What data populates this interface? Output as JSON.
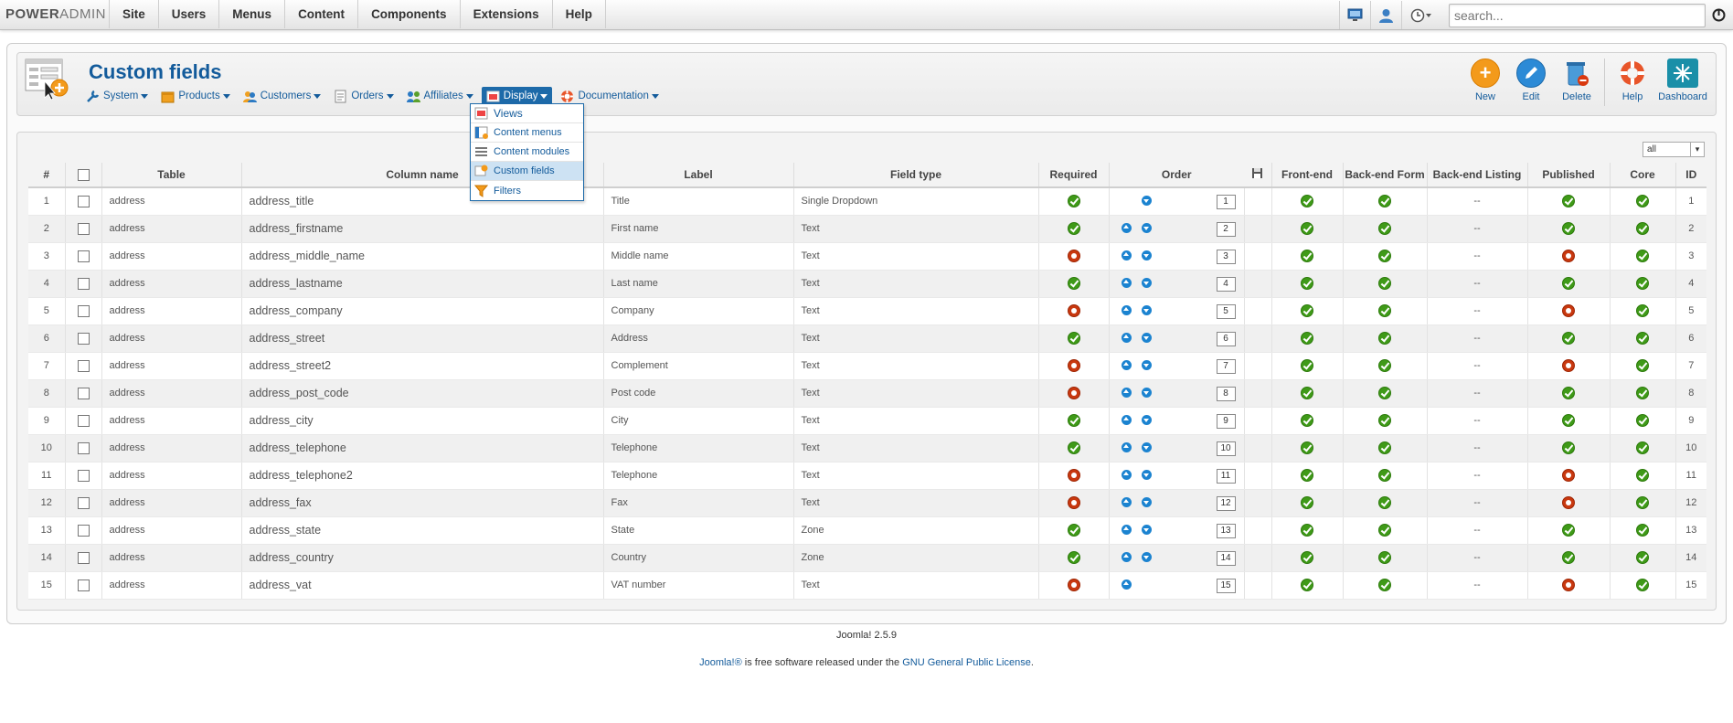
{
  "topbar": {
    "logo_bold": "POWER",
    "logo_thin": "ADMIN",
    "menu": [
      "Site",
      "Users",
      "Menus",
      "Content",
      "Components",
      "Extensions",
      "Help"
    ],
    "search_placeholder": "search..."
  },
  "header": {
    "title": "Custom fields",
    "subnav": [
      "System",
      "Products",
      "Customers",
      "Orders",
      "Affiliates",
      "Display",
      "Documentation"
    ],
    "active_subnav": "Display"
  },
  "toolbar": {
    "new_label": "New",
    "edit_label": "Edit",
    "delete_label": "Delete",
    "help_label": "Help",
    "dashboard_label": "Dashboard"
  },
  "dropdown": {
    "items": [
      "Views",
      "Content menus",
      "Content modules",
      "Custom fields",
      "Filters"
    ],
    "selected": "Custom fields"
  },
  "filter": {
    "value": "all"
  },
  "table": {
    "headers": [
      "#",
      "",
      "Table",
      "Column name",
      "Label",
      "Field type",
      "Required",
      "Order",
      "",
      "Front-end",
      "Back-end Form",
      "Back-end Listing",
      "Published",
      "Core",
      "ID"
    ],
    "rows": [
      {
        "num": "1",
        "table": "address",
        "column": "address_title",
        "label": "Title",
        "type": "Single Dropdown",
        "required": true,
        "up": false,
        "down": true,
        "order": "1",
        "front": true,
        "backform": true,
        "backlist": "--",
        "published": true,
        "core": true,
        "id": "1"
      },
      {
        "num": "2",
        "table": "address",
        "column": "address_firstname",
        "label": "First name",
        "type": "Text",
        "required": true,
        "up": true,
        "down": true,
        "order": "2",
        "front": true,
        "backform": true,
        "backlist": "--",
        "published": true,
        "core": true,
        "id": "2"
      },
      {
        "num": "3",
        "table": "address",
        "column": "address_middle_name",
        "label": "Middle name",
        "type": "Text",
        "required": false,
        "up": true,
        "down": true,
        "order": "3",
        "front": true,
        "backform": true,
        "backlist": "--",
        "published": false,
        "core": true,
        "id": "3"
      },
      {
        "num": "4",
        "table": "address",
        "column": "address_lastname",
        "label": "Last name",
        "type": "Text",
        "required": true,
        "up": true,
        "down": true,
        "order": "4",
        "front": true,
        "backform": true,
        "backlist": "--",
        "published": true,
        "core": true,
        "id": "4"
      },
      {
        "num": "5",
        "table": "address",
        "column": "address_company",
        "label": "Company",
        "type": "Text",
        "required": false,
        "up": true,
        "down": true,
        "order": "5",
        "front": true,
        "backform": true,
        "backlist": "--",
        "published": false,
        "core": true,
        "id": "5"
      },
      {
        "num": "6",
        "table": "address",
        "column": "address_street",
        "label": "Address",
        "type": "Text",
        "required": true,
        "up": true,
        "down": true,
        "order": "6",
        "front": true,
        "backform": true,
        "backlist": "--",
        "published": true,
        "core": true,
        "id": "6"
      },
      {
        "num": "7",
        "table": "address",
        "column": "address_street2",
        "label": "Complement",
        "type": "Text",
        "required": false,
        "up": true,
        "down": true,
        "order": "7",
        "front": true,
        "backform": true,
        "backlist": "--",
        "published": false,
        "core": true,
        "id": "7"
      },
      {
        "num": "8",
        "table": "address",
        "column": "address_post_code",
        "label": "Post code",
        "type": "Text",
        "required": false,
        "up": true,
        "down": true,
        "order": "8",
        "front": true,
        "backform": true,
        "backlist": "--",
        "published": true,
        "core": true,
        "id": "8"
      },
      {
        "num": "9",
        "table": "address",
        "column": "address_city",
        "label": "City",
        "type": "Text",
        "required": true,
        "up": true,
        "down": true,
        "order": "9",
        "front": true,
        "backform": true,
        "backlist": "--",
        "published": true,
        "core": true,
        "id": "9"
      },
      {
        "num": "10",
        "table": "address",
        "column": "address_telephone",
        "label": "Telephone",
        "type": "Text",
        "required": true,
        "up": true,
        "down": true,
        "order": "10",
        "front": true,
        "backform": true,
        "backlist": "--",
        "published": true,
        "core": true,
        "id": "10"
      },
      {
        "num": "11",
        "table": "address",
        "column": "address_telephone2",
        "label": "Telephone",
        "type": "Text",
        "required": false,
        "up": true,
        "down": true,
        "order": "11",
        "front": true,
        "backform": true,
        "backlist": "--",
        "published": false,
        "core": true,
        "id": "11"
      },
      {
        "num": "12",
        "table": "address",
        "column": "address_fax",
        "label": "Fax",
        "type": "Text",
        "required": false,
        "up": true,
        "down": true,
        "order": "12",
        "front": true,
        "backform": true,
        "backlist": "--",
        "published": false,
        "core": true,
        "id": "12"
      },
      {
        "num": "13",
        "table": "address",
        "column": "address_state",
        "label": "State",
        "type": "Zone",
        "required": true,
        "up": true,
        "down": true,
        "order": "13",
        "front": true,
        "backform": true,
        "backlist": "--",
        "published": true,
        "core": true,
        "id": "13"
      },
      {
        "num": "14",
        "table": "address",
        "column": "address_country",
        "label": "Country",
        "type": "Zone",
        "required": true,
        "up": true,
        "down": true,
        "order": "14",
        "front": true,
        "backform": true,
        "backlist": "--",
        "published": true,
        "core": true,
        "id": "14"
      },
      {
        "num": "15",
        "table": "address",
        "column": "address_vat",
        "label": "VAT number",
        "type": "Text",
        "required": false,
        "up": true,
        "down": false,
        "order": "15",
        "front": true,
        "backform": true,
        "backlist": "--",
        "published": false,
        "core": true,
        "id": "15"
      }
    ]
  },
  "footer": {
    "version": "Joomla! 2.5.9",
    "license_prefix": "Joomla!®",
    "license_middle": " is free software released under the ",
    "license_link": "GNU General Public License",
    "license_suffix": "."
  },
  "colors": {
    "link": "#135b9b",
    "ok": "#3f9a18",
    "no": "#c8380f",
    "arrow": "#1b83d0",
    "active_tab": "#1d6aa9"
  }
}
